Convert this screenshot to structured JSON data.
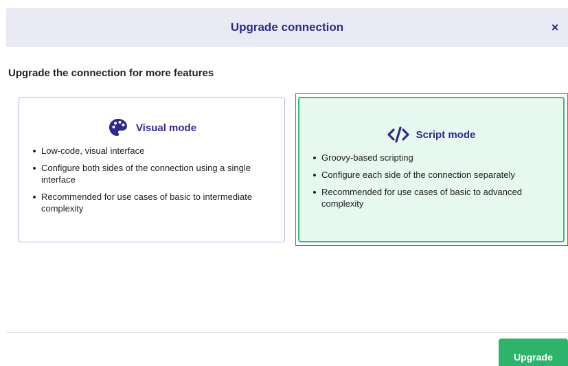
{
  "dialog": {
    "title": "Upgrade connection",
    "close_label": "×",
    "subtitle": "Upgrade the connection for more features"
  },
  "modes": {
    "visual": {
      "icon": "palette-icon",
      "title": "Visual mode",
      "features": [
        "Low-code, visual interface",
        "Configure both sides of the connection using a single interface",
        "Recommended for use cases of basic to intermediate complexity"
      ]
    },
    "script": {
      "icon": "code-icon",
      "title": "Script mode",
      "selected": true,
      "features": [
        "Groovy-based scripting",
        "Configure each side of the connection separately",
        "Recommended for use cases of basic to advanced complexity"
      ]
    }
  },
  "footer": {
    "upgrade_label": "Upgrade"
  },
  "colors": {
    "accent": "#2f2b8c",
    "header_bg": "#e9eaf3",
    "selected_bg": "#e6f8ef",
    "selected_border": "#3cb878",
    "highlight_outline": "#e5403a",
    "primary_button": "#2db36b"
  }
}
